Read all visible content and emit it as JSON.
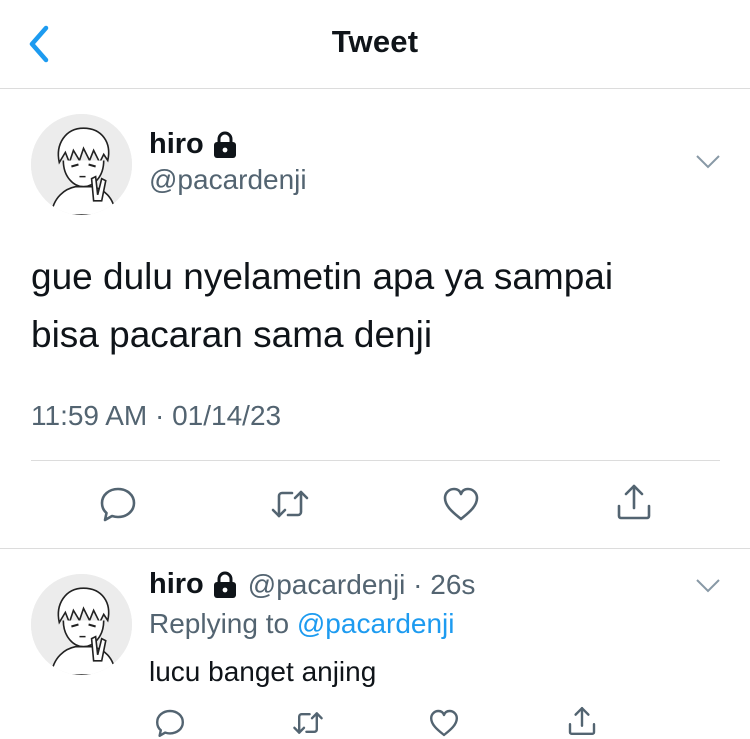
{
  "header": {
    "title": "Tweet"
  },
  "colors": {
    "accent": "#1d9bf0",
    "text": "#0f1419",
    "secondary": "#536471",
    "divider": "#dcdcdc"
  },
  "tweet": {
    "author_name": "hiro",
    "handle": "@pacardenji",
    "text_line1": "gue dulu nyelametin apa ya sampai",
    "text_line2": "bisa pacaran sama denji",
    "timestamp": "11:59 AM · 01/14/23",
    "icons": [
      "reply-icon",
      "retweet-icon",
      "like-icon",
      "share-icon"
    ]
  },
  "reply": {
    "author_name": "hiro",
    "handle_time": "@pacardenji · 26s",
    "replying_prefix": "Replying to",
    "replying_to": "@pacardenji",
    "text": "lucu banget anjing",
    "icons": [
      "reply-icon",
      "retweet-icon",
      "like-icon",
      "share-icon"
    ]
  }
}
